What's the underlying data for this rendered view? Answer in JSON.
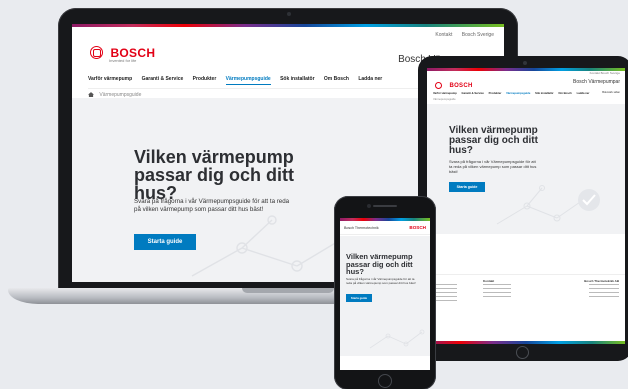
{
  "site": {
    "brand": "BOSCH",
    "tagline": "Invented for life",
    "title": "Bosch Värmepumpar",
    "top_links": [
      "Kontakt",
      "Bosch Sverige"
    ],
    "nav": [
      {
        "label": "Varför värmepump",
        "active": false
      },
      {
        "label": "Garanti & Service",
        "active": false
      },
      {
        "label": "Produkter",
        "active": false
      },
      {
        "label": "Värmepumpsguide",
        "active": true
      },
      {
        "label": "Sök installatör",
        "active": false
      },
      {
        "label": "Om Bosch",
        "active": false
      },
      {
        "label": "Ladda ner",
        "active": false
      }
    ],
    "breadcrumb": "Värmepumpsguide"
  },
  "hero": {
    "heading": "Vilken värmepump passar dig och ditt hus?",
    "body": "Svara på frågorna i vår Värmepumpsguide för att ta reda på vilken värmepump som passar ditt hus bäst!",
    "cta": "Starta guide"
  },
  "phone": {
    "site_title": "Bosch Thermotechnik",
    "brand": "BOSCH"
  },
  "tablet_footer": {
    "col1_heading": "Kontakt",
    "col2_heading": "Bosch Thermoteknik AB",
    "bookmark_label": "Bokmärk sidan"
  },
  "colors": {
    "brand_red": "#e20015",
    "accent_blue": "#007bc0",
    "hero_bg": "#f1f2f4",
    "device_frame": "#17181b"
  },
  "icons": [
    "home-icon",
    "bosch-logo-icon",
    "checkmark-circle-icon"
  ]
}
